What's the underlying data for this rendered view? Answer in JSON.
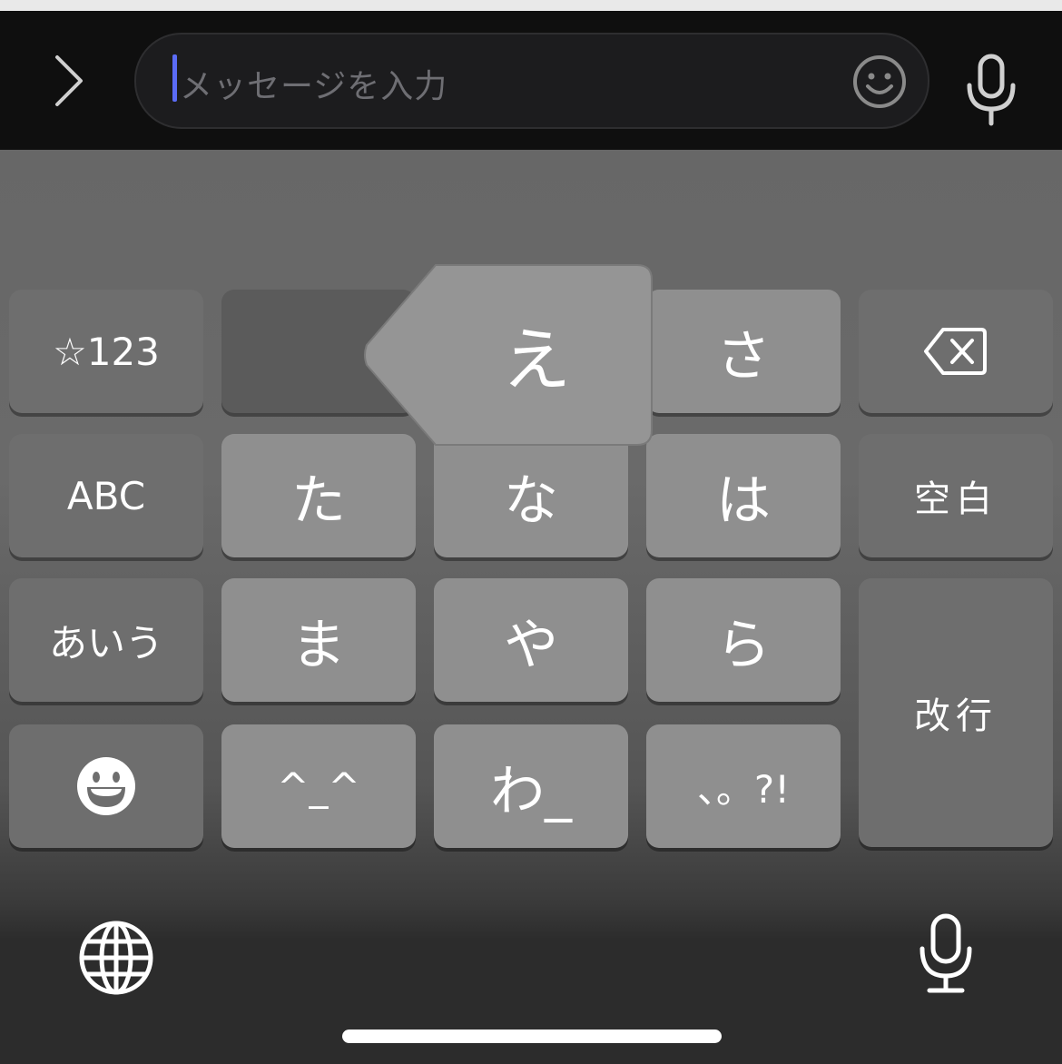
{
  "input": {
    "placeholder": "メッセージを入力"
  },
  "keyboard": {
    "popup_char": "え",
    "rows": [
      [
        "☆123",
        "",
        "さ",
        "delete"
      ],
      [
        "ABC",
        "た",
        "な",
        "は",
        "空白"
      ],
      [
        "あいう",
        "ま",
        "や",
        "ら",
        "改行"
      ],
      [
        "emoji",
        "^_^",
        "わ_",
        "、。?!"
      ]
    ],
    "keys": {
      "num": "☆123",
      "sa": "さ",
      "abc": "ABC",
      "ta": "た",
      "na": "な",
      "ha": "は",
      "space": "空白",
      "aiu": "あいう",
      "ma": "ま",
      "ya": "や",
      "ra": "ら",
      "enter": "改行",
      "face": "^_^",
      "wa": "わ_",
      "punct": "、。?!"
    }
  },
  "colors": {
    "caret": "#5b6cf6",
    "key_light": "#8f8f8f",
    "key_dark": "#6e6e6e"
  },
  "icons": {
    "expand": "chevron-right-icon",
    "emoji": "smiley-icon",
    "mic": "microphone-icon",
    "delete": "backspace-icon",
    "globe": "globe-icon",
    "emoji_key": "grinning-face-icon"
  }
}
